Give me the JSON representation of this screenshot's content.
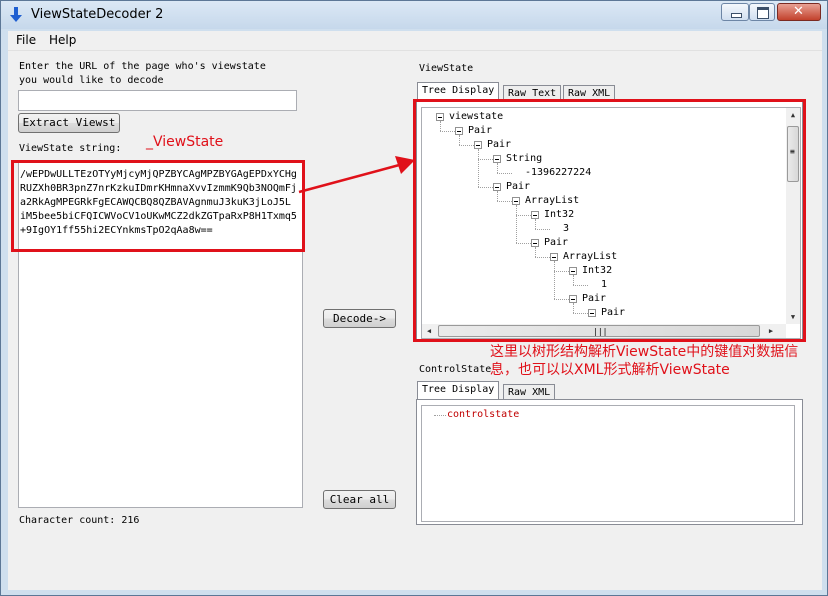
{
  "window": {
    "title": "ViewStateDecoder 2",
    "min_glyph": "▭",
    "max_glyph": "□",
    "close_glyph": "✕"
  },
  "menu": {
    "items": [
      "File",
      "Help"
    ]
  },
  "left": {
    "url_prompt_line1": "Enter the URL of the page who's viewstate",
    "url_prompt_line2": "you would like to decode",
    "url_value": "",
    "extract_button": "Extract Viewst",
    "viewstate_label": "ViewState string:",
    "viewstate_lines": [
      "/wEPDwULLTEzOTYyMjcyMjQPZBYCAgMPZBYGAgEPDxYCHg",
      "RUZXh0BR3pnZ7nrKzkuIDmrKHmnaXvvIzmmK9Qb3NOQmFj",
      "a2RkAgMPEGRkFgECAWQCBQ8QZBAVAgnmuJ3kuK3jLoJ5L",
      "iM5bee5biCFQICWVoCV1oUKwMCZ2dkZGTpaRxP8H1Txmq5",
      "+9IgOY1ff55hi2ECYnkmsTpO2qAa8w=="
    ],
    "char_count": "Character count: 216"
  },
  "middle": {
    "decode_button": "Decode->",
    "clear_button": "Clear all"
  },
  "right": {
    "viewstate_heading": "ViewState",
    "tabs": [
      "Tree Display",
      "Raw Text",
      "Raw XML"
    ],
    "tree": [
      {
        "label": "viewstate",
        "depth": 0,
        "expander": true
      },
      {
        "label": "Pair",
        "depth": 1,
        "expander": true
      },
      {
        "label": "Pair",
        "depth": 2,
        "expander": true
      },
      {
        "label": "String",
        "depth": 3,
        "expander": true
      },
      {
        "label": "-1396227224",
        "depth": 4,
        "expander": false
      },
      {
        "label": "Pair",
        "depth": 3,
        "expander": true
      },
      {
        "label": "ArrayList",
        "depth": 4,
        "expander": true
      },
      {
        "label": "Int32",
        "depth": 5,
        "expander": true
      },
      {
        "label": "3",
        "depth": 6,
        "expander": false
      },
      {
        "label": "Pair",
        "depth": 5,
        "expander": true
      },
      {
        "label": "ArrayList",
        "depth": 6,
        "expander": true
      },
      {
        "label": "Int32",
        "depth": 7,
        "expander": true
      },
      {
        "label": "1",
        "depth": 8,
        "expander": false
      },
      {
        "label": "Pair",
        "depth": 7,
        "expander": true
      },
      {
        "label": "Pair",
        "depth": 8,
        "expander": true
      }
    ],
    "controlstate_heading": "ControlState",
    "controlstate_tabs": [
      "Tree Display",
      "Raw XML"
    ],
    "controlstate_root": "controlstate"
  },
  "annotations": {
    "viewstate_label": "_ViewState",
    "tree_note_line1": "这里以树形结构解析ViewState中的键值对数据信",
    "tree_note_line2": "息，也可以以XML形式解析ViewState"
  },
  "colors": {
    "annotation_red": "#e0111a",
    "controlstate_text": "#c00000",
    "titlebar": "#c6d8eb"
  },
  "icons": {
    "app": "down-arrow-icon",
    "scroll_up": "▲",
    "scroll_down": "▼",
    "scroll_left": "◀",
    "scroll_right": "▶",
    "grip": "≡",
    "grip_h": "|||"
  }
}
